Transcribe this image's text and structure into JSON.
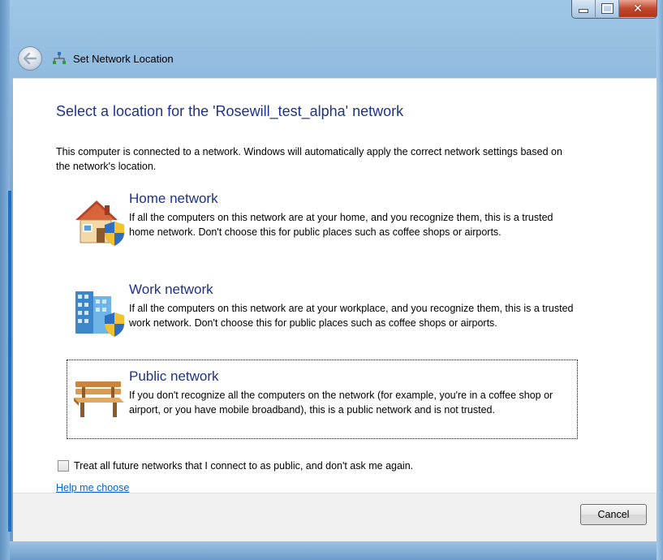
{
  "window": {
    "title": "Set Network Location",
    "controls": {
      "minimize": "minimize-icon",
      "maximize": "maximize-icon",
      "close": "close-icon"
    }
  },
  "main": {
    "heading": "Select a location for the 'Rosewill_test_alpha' network",
    "description": "This computer is connected to a network. Windows will automatically apply the correct network settings based on the network's location.",
    "options": [
      {
        "title": "Home network",
        "description": "If all the computers on this network are at your home, and you recognize them, this is a trusted home network.  Don't choose this for public places such as coffee shops or airports.",
        "icon": "house-shield-icon"
      },
      {
        "title": "Work network",
        "description": "If all the computers on this network are at your workplace, and you recognize them, this is a trusted work network.  Don't choose this for public places such as coffee shops or airports.",
        "icon": "office-building-shield-icon"
      },
      {
        "title": "Public network",
        "description": "If you don't recognize all the computers on the network (for example, you're in a coffee shop or airport, or you have mobile broadband), this is a public network and is not trusted.",
        "icon": "park-bench-icon"
      }
    ],
    "checkbox_label": "Treat all future networks that I connect to as public, and don't ask me again.",
    "checkbox_checked": false,
    "help_link": "Help me choose"
  },
  "footer": {
    "cancel_label": "Cancel"
  },
  "colors": {
    "heading": "#1e3287",
    "link": "#0066cc",
    "close_button": "#c1492c"
  }
}
